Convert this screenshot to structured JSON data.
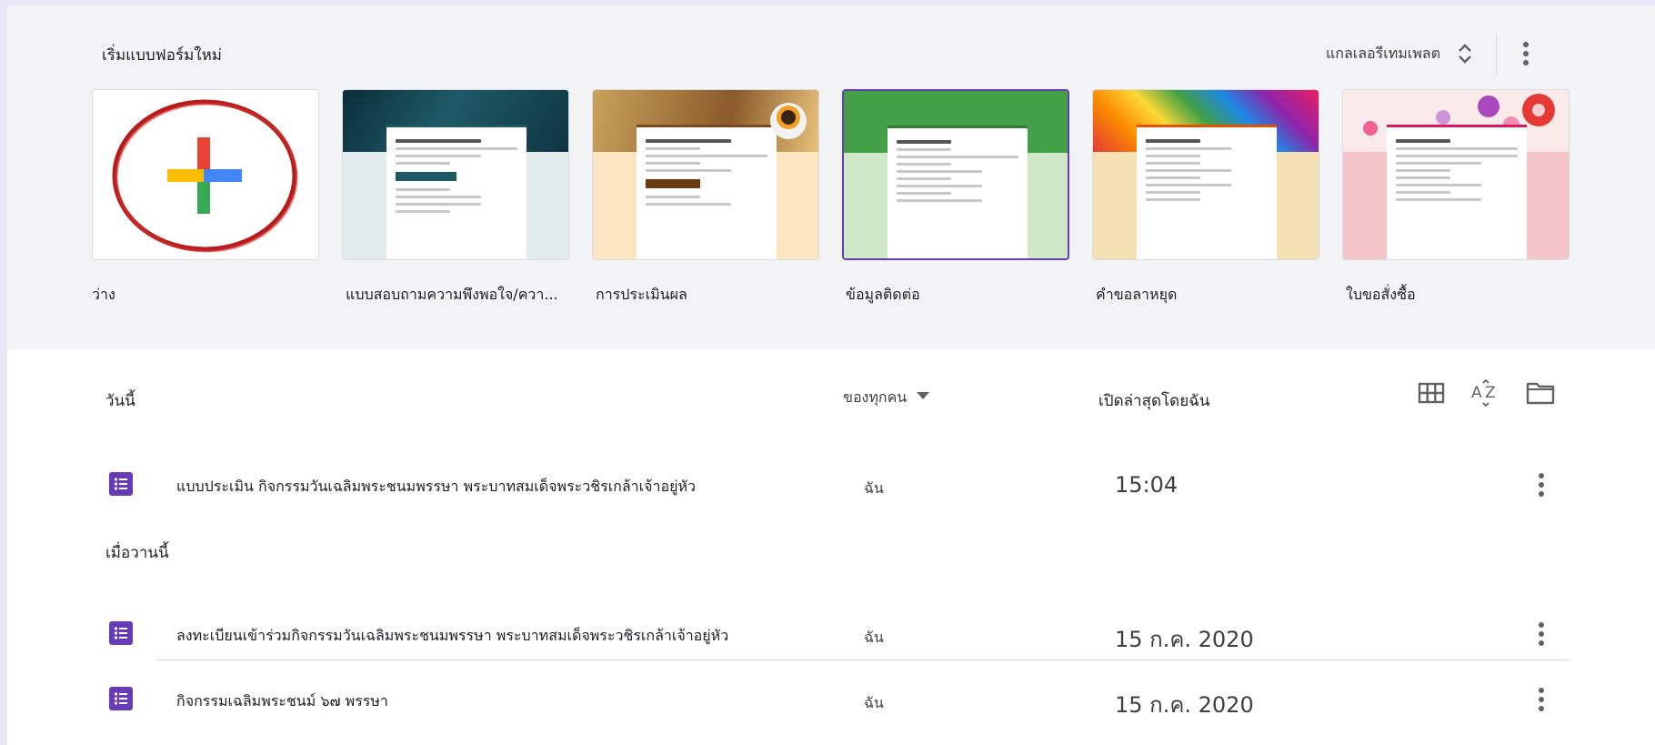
{
  "gallery": {
    "title": "เริ่มแบบฟอร์มใหม่",
    "template_gallery_label": "แกลเลอรีเทมเพลต",
    "templates": [
      {
        "label": "ว่าง",
        "selected": false,
        "theme": "blank"
      },
      {
        "label": "แบบสอบถามความพึงพอใจ/ควา...",
        "selected": false,
        "theme": "#0f3f4a"
      },
      {
        "label": "การประเมินผล",
        "selected": false,
        "theme": "#fbe5c1"
      },
      {
        "label": "ข้อมูลติดต่อ",
        "selected": true,
        "theme": "#4caf50"
      },
      {
        "label": "คำขอลาหยุด",
        "selected": false,
        "theme": "#f5d8a8"
      },
      {
        "label": "ใบขอสั่งซื้อ",
        "selected": false,
        "theme": "#f4c6c6"
      }
    ]
  },
  "recent": {
    "today_label": "วันนี้",
    "owner_filter": "ของทุกคน",
    "sort_label": "เปิดล่าสุดโดยฉัน",
    "yesterday_label": "เมื่อวานนี้",
    "today_items": [
      {
        "title": "แบบประเมิน กิจกรรมวันเฉลิมพระชนมพรรษา พระบาทสมเด็จพระวชิรเกล้าเจ้าอยู่หัว",
        "owner": "ฉัน",
        "date": "15:04"
      }
    ],
    "earlier_items": [
      {
        "title": "ลงทะเบียนเข้าร่วมกิจกรรมวันเฉลิมพระชนมพรรษา พระบาทสมเด็จพระวชิรเกล้าเจ้าอยู่หัว",
        "owner": "ฉัน",
        "date": "15 ก.ค. 2020"
      },
      {
        "title": "กิจกรรมเฉลิมพระชนม์ ๖๗ พรรษา",
        "owner": "ฉัน",
        "date": "15 ก.ค. 2020"
      }
    ]
  },
  "colors": {
    "accent": "#673ab7",
    "highlight_ring": "#c62828"
  },
  "icons": [
    "unfold-more-icon",
    "more-vert-icon",
    "plus-icon",
    "grid-view-icon",
    "sort-az-icon",
    "folder-icon",
    "form-icon",
    "arrow-drop-down-icon"
  ]
}
